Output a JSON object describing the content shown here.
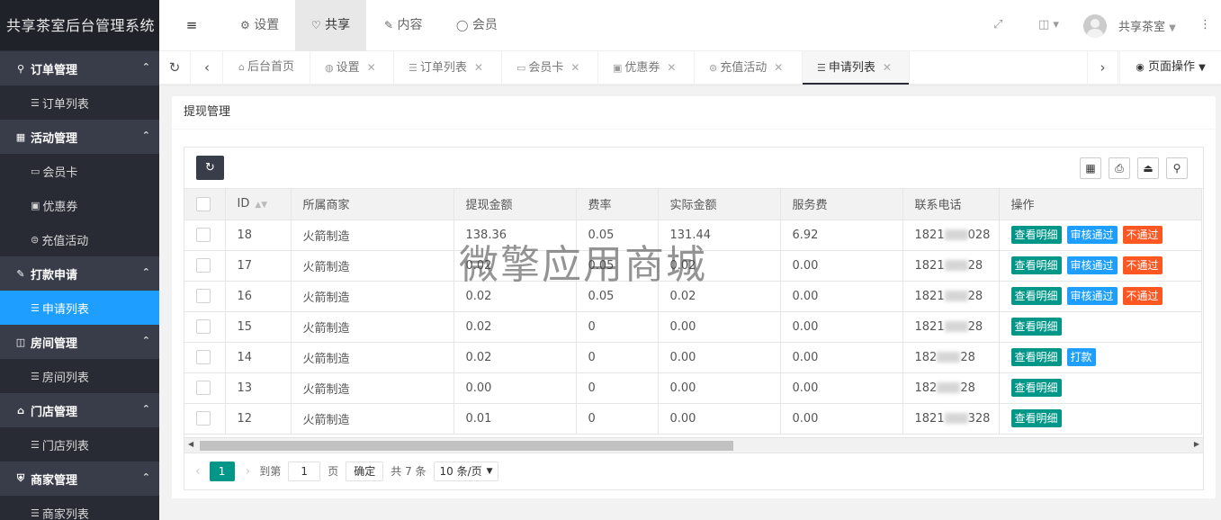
{
  "app": {
    "title": "共享茶室后台管理系统"
  },
  "sidebar": {
    "groups": [
      {
        "label": "订单管理",
        "items": [
          {
            "label": "订单列表",
            "active": false
          }
        ]
      },
      {
        "label": "活动管理",
        "items": [
          {
            "label": "会员卡",
            "active": false
          },
          {
            "label": "优惠券",
            "active": false
          },
          {
            "label": "充值活动",
            "active": false
          }
        ]
      },
      {
        "label": "打款申请",
        "items": [
          {
            "label": "申请列表",
            "active": true
          }
        ]
      },
      {
        "label": "房间管理",
        "items": [
          {
            "label": "房间列表",
            "active": false
          }
        ]
      },
      {
        "label": "门店管理",
        "items": [
          {
            "label": "门店列表",
            "active": false
          }
        ]
      },
      {
        "label": "商家管理",
        "items": [
          {
            "label": "商家列表",
            "active": false
          }
        ]
      }
    ]
  },
  "header": {
    "nav": [
      {
        "label": "设置",
        "active": false
      },
      {
        "label": "共享",
        "active": true
      },
      {
        "label": "内容",
        "active": false
      },
      {
        "label": "会员",
        "active": false
      }
    ],
    "user": "共享茶室"
  },
  "tabs": [
    {
      "label": "后台首页",
      "closable": false,
      "active": false
    },
    {
      "label": "设置",
      "closable": true,
      "active": false
    },
    {
      "label": "订单列表",
      "closable": true,
      "active": false
    },
    {
      "label": "会员卡",
      "closable": true,
      "active": false
    },
    {
      "label": "优惠券",
      "closable": true,
      "active": false
    },
    {
      "label": "充值活动",
      "closable": true,
      "active": false
    },
    {
      "label": "申请列表",
      "closable": true,
      "active": true
    }
  ],
  "page_ops": "页面操作",
  "card": {
    "title": "提现管理"
  },
  "table": {
    "columns": [
      "ID",
      "所属商家",
      "提现金额",
      "费率",
      "实际金额",
      "服务费",
      "联系电话",
      "操作"
    ],
    "rows": [
      {
        "id": "18",
        "merchant": "火箭制造",
        "amount": "138.36",
        "rate": "0.05",
        "actual": "131.44",
        "fee": "6.92",
        "phone_prefix": "1821",
        "phone_suffix": "028",
        "actions": [
          "查看明细",
          "审核通过",
          "不通过"
        ]
      },
      {
        "id": "17",
        "merchant": "火箭制造",
        "amount": "0.02",
        "rate": "0.05",
        "actual": "0.02",
        "fee": "0.00",
        "phone_prefix": "1821",
        "phone_suffix": "28",
        "actions": [
          "查看明细",
          "审核通过",
          "不通过"
        ]
      },
      {
        "id": "16",
        "merchant": "火箭制造",
        "amount": "0.02",
        "rate": "0.05",
        "actual": "0.02",
        "fee": "0.00",
        "phone_prefix": "1821",
        "phone_suffix": "28",
        "actions": [
          "查看明细",
          "审核通过",
          "不通过"
        ]
      },
      {
        "id": "15",
        "merchant": "火箭制造",
        "amount": "0.02",
        "rate": "0",
        "actual": "0.00",
        "fee": "0.00",
        "phone_prefix": "1821",
        "phone_suffix": "28",
        "actions": [
          "查看明细"
        ]
      },
      {
        "id": "14",
        "merchant": "火箭制造",
        "amount": "0.02",
        "rate": "0",
        "actual": "0.00",
        "fee": "0.00",
        "phone_prefix": "182",
        "phone_suffix": "28",
        "actions": [
          "查看明细",
          "打款"
        ]
      },
      {
        "id": "13",
        "merchant": "火箭制造",
        "amount": "0.00",
        "rate": "0",
        "actual": "0.00",
        "fee": "0.00",
        "phone_prefix": "182",
        "phone_suffix": "28",
        "actions": [
          "查看明细"
        ]
      },
      {
        "id": "12",
        "merchant": "火箭制造",
        "amount": "0.01",
        "rate": "0",
        "actual": "0.00",
        "fee": "0.00",
        "phone_prefix": "1821",
        "phone_suffix": "328",
        "actions": [
          "查看明细"
        ]
      }
    ]
  },
  "pager": {
    "current": "1",
    "goto_label": "到第",
    "goto_value": "1",
    "page_unit": "页",
    "confirm": "确定",
    "total": "共 7 条",
    "per_page": "10 条/页"
  },
  "watermark": "微擎应用商城",
  "colors": {
    "sidebar_bg": "#20222a",
    "active_blue": "#1e9fff",
    "green": "#009688",
    "red": "#ff5722"
  }
}
